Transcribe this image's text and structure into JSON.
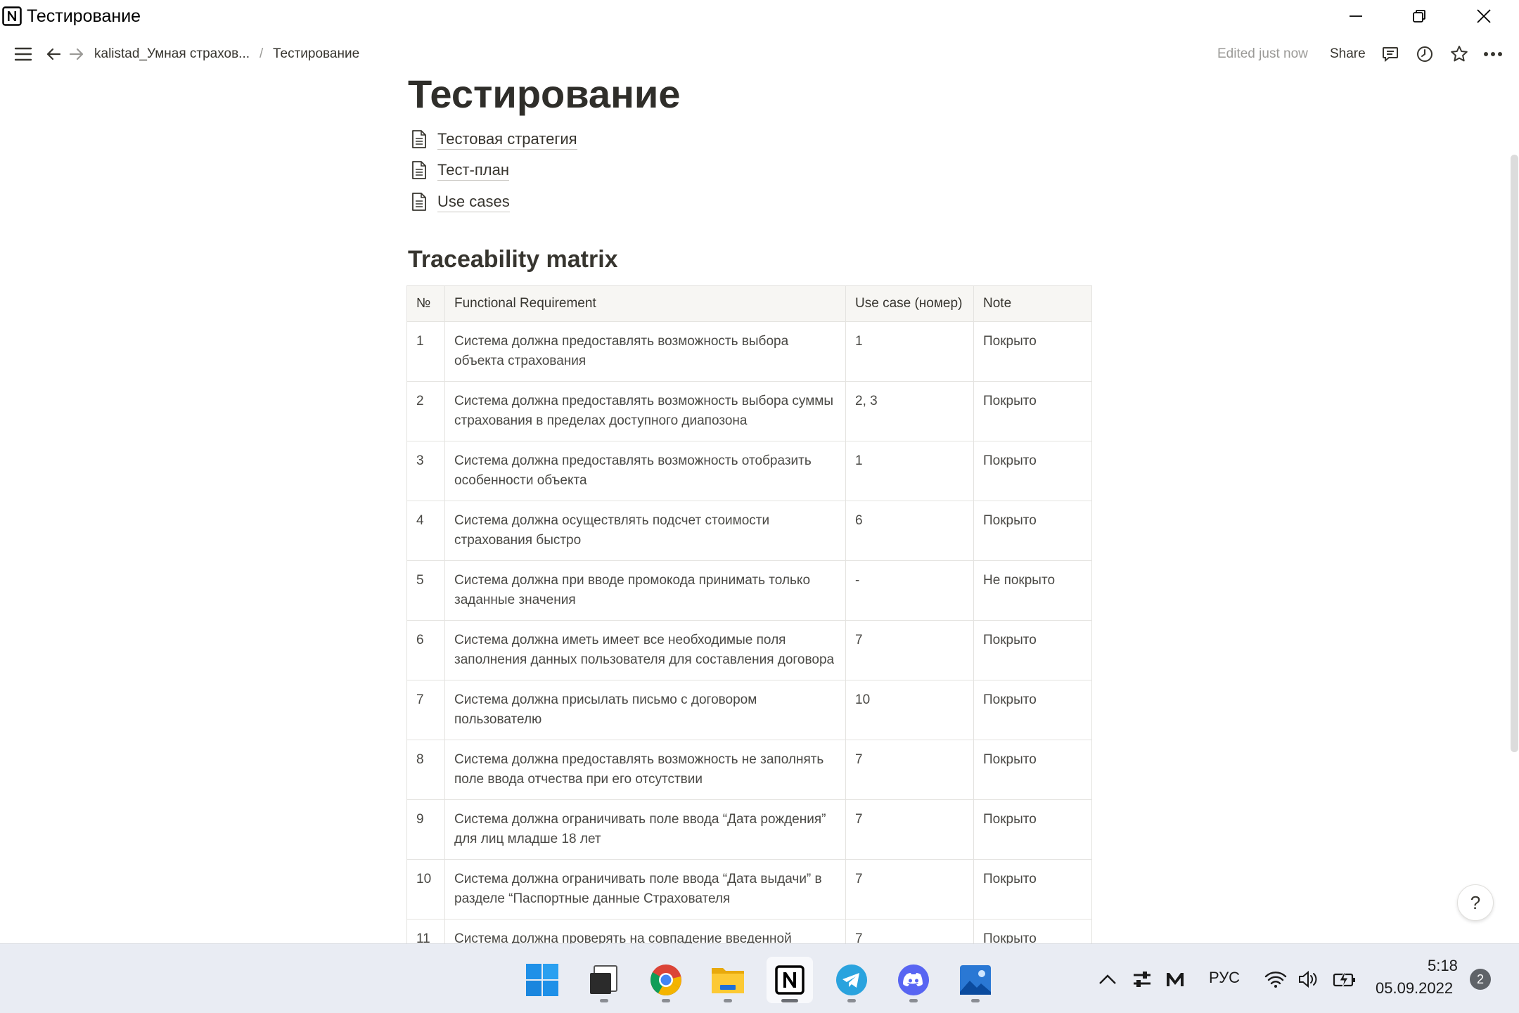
{
  "window": {
    "title": "Тестирование"
  },
  "topbar": {
    "breadcrumb": [
      "kalistad_Умная страхов...",
      "Тестирование"
    ],
    "separator": "/",
    "edited": "Edited just now",
    "share_label": "Share"
  },
  "page": {
    "title": "Тестирование",
    "subpages": [
      "Тестовая стратегия",
      "Тест-план",
      "Use cases"
    ],
    "section_heading": "Traceability matrix"
  },
  "table": {
    "headers": [
      "№",
      "Functional Requirement",
      "Use case (номер)",
      "Note"
    ],
    "rows": [
      [
        "1",
        "Система должна предоставлять возможность выбора объекта страхования",
        "1",
        "Покрыто"
      ],
      [
        "2",
        "Система должна предоставлять возможность выбора суммы страхования в пределах доступного диапозона",
        "2, 3",
        "Покрыто"
      ],
      [
        "3",
        "Система должна предоставлять возможность отобразить особенности объекта",
        "1",
        "Покрыто"
      ],
      [
        "4",
        "Система должна осуществлять подсчет стоимости страхования быстро",
        "6",
        "Покрыто"
      ],
      [
        "5",
        "Система должна при вводе промокода принимать только заданные значения",
        "-",
        "Не покрыто"
      ],
      [
        "6",
        "Система должна иметь имеет все необходимые поля заполнения данных пользователя для составления договора",
        "7",
        "Покрыто"
      ],
      [
        "7",
        "Система должна присылать письмо с договором пользователю",
        "10",
        "Покрыто"
      ],
      [
        "8",
        "Система должна предоставлять возможность не заполнять поле ввода отчества при его отсутствии",
        "7",
        "Покрыто"
      ],
      [
        "9",
        "Система должна ограничивать поле ввода “Дата рождения” для лиц младше 18 лет",
        "7",
        "Покрыто"
      ],
      [
        "10",
        "Система должна ограничивать поле ввода “Дата выдачи” в разделе “Паспортные данные Страхователя",
        "7",
        "Покрыто"
      ],
      [
        "11",
        "Система должна проверять на совпадение введенной повторно электронной почты",
        "7",
        "Покрыто"
      ]
    ]
  },
  "help": {
    "label": "?"
  },
  "taskbar": {
    "apps": [
      "start-icon",
      "file-viewer-icon",
      "chrome-icon",
      "file-explorer-icon",
      "notion-icon",
      "telegram-icon",
      "discord-icon",
      "photos-icon"
    ],
    "language": "РУС",
    "time": "5:18",
    "date": "05.09.2022",
    "notification_count": "2"
  },
  "colors": {
    "text": "#37352f",
    "muted": "#9b9a97",
    "header_bg": "#f7f6f3",
    "border": "#e4e3e0",
    "taskbar_bg": "#e9ecf3"
  }
}
